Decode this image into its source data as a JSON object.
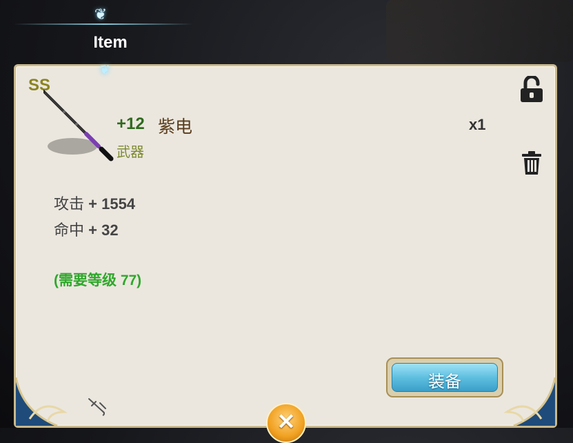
{
  "header": {
    "title": "Item"
  },
  "item": {
    "grade": "SS",
    "enhance": "+12",
    "name": "紫电",
    "type": "武器",
    "quantity": "x1",
    "stats": [
      {
        "label": "攻击",
        "value": "+ 1554"
      },
      {
        "label": "命中",
        "value": "+ 32"
      }
    ],
    "requirement": "(需要等级 77)"
  },
  "actions": {
    "equip_label": "装备",
    "lock_icon": "unlocked-padlock-icon",
    "trash_icon": "trash-icon",
    "close_icon": "close-icon",
    "pin_icon": "fishing-hook-icon"
  },
  "colors": {
    "panel_bg": "#ebe7df",
    "enhance": "#2f6a1e",
    "item_name": "#5a3d1c",
    "item_type": "#7c8a2e",
    "requirement": "#2fa82b",
    "equip_button": "#5fbfe0",
    "close_button": "#f0a020"
  }
}
